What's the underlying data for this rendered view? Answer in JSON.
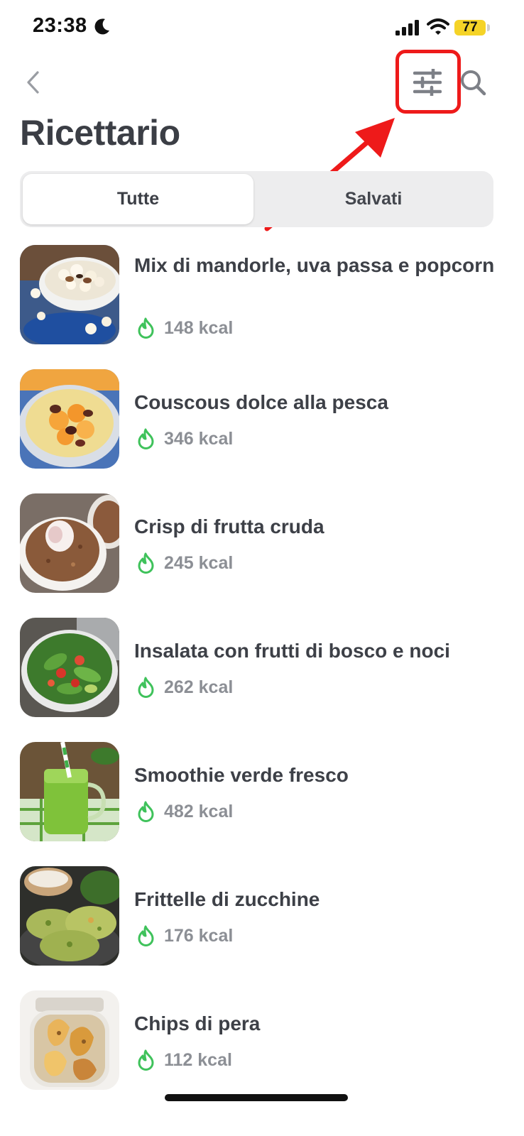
{
  "status_bar": {
    "time": "23:38",
    "battery": "77",
    "icons": [
      "moon-icon",
      "signal-icon",
      "wifi-icon",
      "battery-icon"
    ]
  },
  "header": {
    "back_icon": "chevron-left-icon",
    "filter_icon": "sliders-icon",
    "search_icon": "search-icon",
    "title": "Ricettario"
  },
  "tabs": [
    {
      "label": "Tutte",
      "active": true
    },
    {
      "label": "Salvati",
      "active": false
    }
  ],
  "recipes": [
    {
      "name": "Mix di mandorle, uva passa e popcorn",
      "kcal": "148 kcal"
    },
    {
      "name": "Couscous dolce alla pesca",
      "kcal": "346 kcal"
    },
    {
      "name": "Crisp di frutta cruda",
      "kcal": "245 kcal"
    },
    {
      "name": "Insalata con frutti di bosco e noci",
      "kcal": "262 kcal"
    },
    {
      "name": "Smoothie verde fresco",
      "kcal": "482 kcal"
    },
    {
      "name": "Frittelle di zucchine",
      "kcal": "176 kcal"
    },
    {
      "name": "Chips di pera",
      "kcal": "112 kcal"
    }
  ],
  "colors": {
    "accent_green": "#3fc25b",
    "highlight_red": "#ee1a1a",
    "battery_yellow": "#f5d327"
  }
}
